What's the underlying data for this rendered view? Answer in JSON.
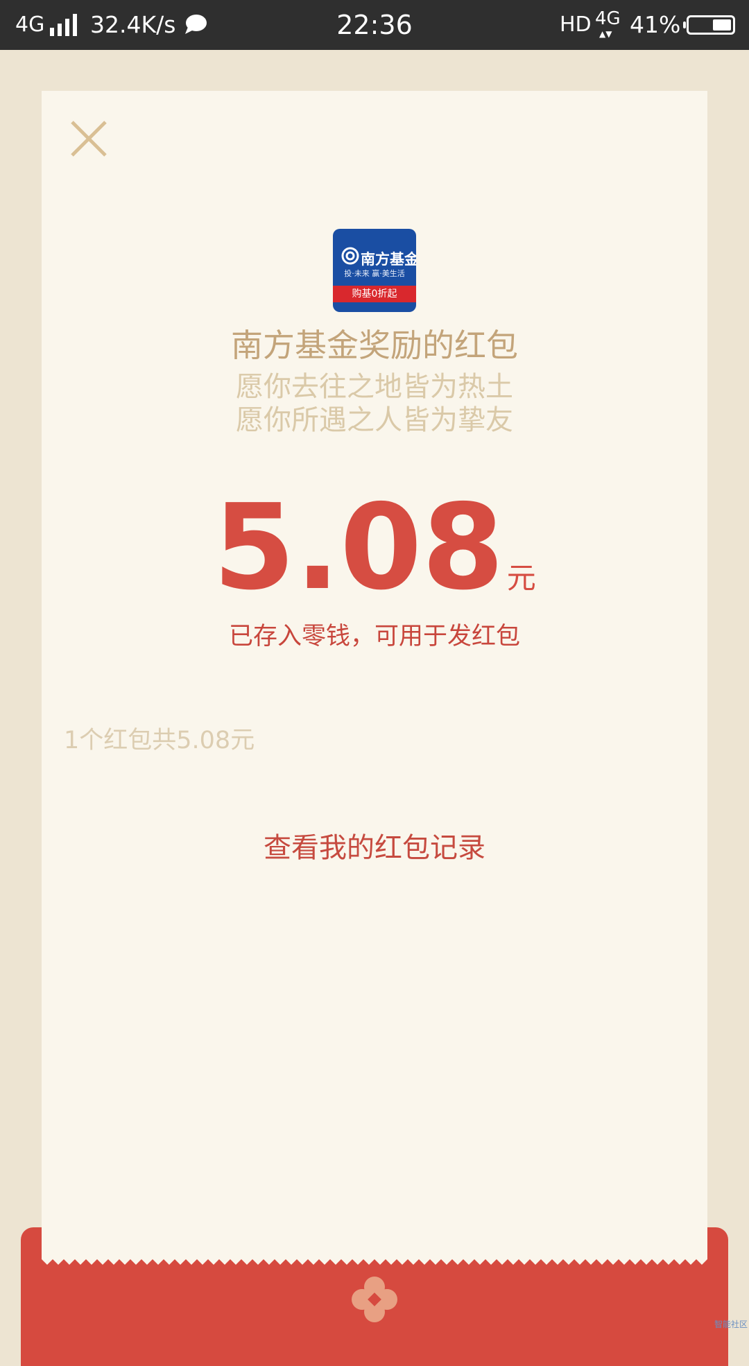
{
  "status_bar": {
    "network": "4G",
    "speed": "32.4K/s",
    "time": "22:36",
    "hd": "HD",
    "network2": "4G",
    "battery": "41%",
    "icons": [
      "signal-icon",
      "chat-icon",
      "data-arrows-icon",
      "battery-icon"
    ]
  },
  "close_icon": "close-icon",
  "logo": {
    "brand": "南方基金",
    "tagline": "投·未来 赢·美生活",
    "ribbon": "购基0折起"
  },
  "red_packet": {
    "title": "南方基金奖励的红包",
    "wish_line1": "愿你去往之地皆为热土",
    "wish_line2": "愿你所遇之人皆为挚友",
    "amount": "5.08",
    "unit": "元",
    "saved_note": "已存入零钱，可用于发红包",
    "summary": "1个红包共5.08元",
    "records_link": "查看我的红包记录"
  },
  "watermark": "智能社区",
  "colors": {
    "background": "#ede4d2",
    "card": "#faf6ec",
    "accent_red": "#d64d42",
    "gold_text": "#c3a47a",
    "envelope": "#d64a3f"
  }
}
